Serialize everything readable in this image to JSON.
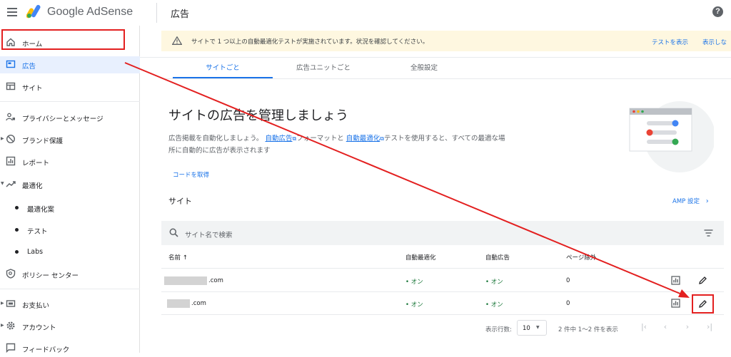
{
  "header": {
    "brand": "Google AdSense",
    "page_title": "広告",
    "help": "?"
  },
  "sidebar": {
    "items": [
      {
        "label": "ホーム"
      },
      {
        "label": "広告"
      },
      {
        "label": "サイト"
      },
      {
        "label": "プライバシーとメッセージ"
      },
      {
        "label": "ブランド保護"
      },
      {
        "label": "レポート"
      },
      {
        "label": "最適化"
      },
      {
        "label": "最適化案"
      },
      {
        "label": "テスト"
      },
      {
        "label": "Labs"
      },
      {
        "label": "ポリシー センター"
      },
      {
        "label": "お支払い"
      },
      {
        "label": "アカウント"
      },
      {
        "label": "フィードバック"
      }
    ]
  },
  "banner": {
    "message": "サイトで 1 つ以上の自動最適化テストが実施されています。状況を確認してください。",
    "action1": "テストを表示",
    "action2": "表示しな"
  },
  "tabs": [
    {
      "label": "サイトごと"
    },
    {
      "label": "広告ユニットごと"
    },
    {
      "label": "全般設定"
    }
  ],
  "hero": {
    "title": "サイトの広告を管理しましょう",
    "desc_1": "広告掲載を自動化しましょう。",
    "link_1": "自動広告",
    "desc_2": "フォーマットと",
    "link_2": "自動最適化",
    "desc_3": "テストを使用すると、すべての最適な場所に自動的に広告が表示されます",
    "code_link": "コードを取得"
  },
  "section": {
    "title": "サイト",
    "amp_link": "AMP 設定"
  },
  "search": {
    "placeholder": "サイト名で検索"
  },
  "table": {
    "headers": {
      "name": "名前 ↑",
      "auto_opt": "自動最適化",
      "auto_ads": "自動広告",
      "excluded": "ページ除外"
    },
    "rows": [
      {
        "name": ".com",
        "auto_opt": "• オン",
        "auto_ads": "• オン",
        "excluded": "0"
      },
      {
        "name": ".com",
        "auto_opt": "• オン",
        "auto_ads": "• オン",
        "excluded": "0"
      }
    ]
  },
  "pager": {
    "rows_per_page_label": "表示行数:",
    "rows_per_page": "10",
    "count": "2 件中 1〜2 件を表示"
  },
  "colors": {
    "accent": "#1a73e8",
    "annotation": "#e32020",
    "status_on": "#137333"
  },
  "icons": {
    "menu": "menu-icon",
    "help": "help-icon",
    "home": "home-icon",
    "ads": "ads-icon",
    "sites": "sites-icon",
    "privacy": "privacy-icon",
    "brand": "block-icon",
    "reports": "reports-icon",
    "optimize": "trending-icon",
    "policy": "policy-icon",
    "payments": "payments-icon",
    "account": "gear-icon",
    "feedback": "feedback-icon",
    "warning": "warning-icon",
    "search": "search-icon",
    "filter": "filter-icon",
    "chart": "chart-icon",
    "edit": "pencil-icon"
  }
}
